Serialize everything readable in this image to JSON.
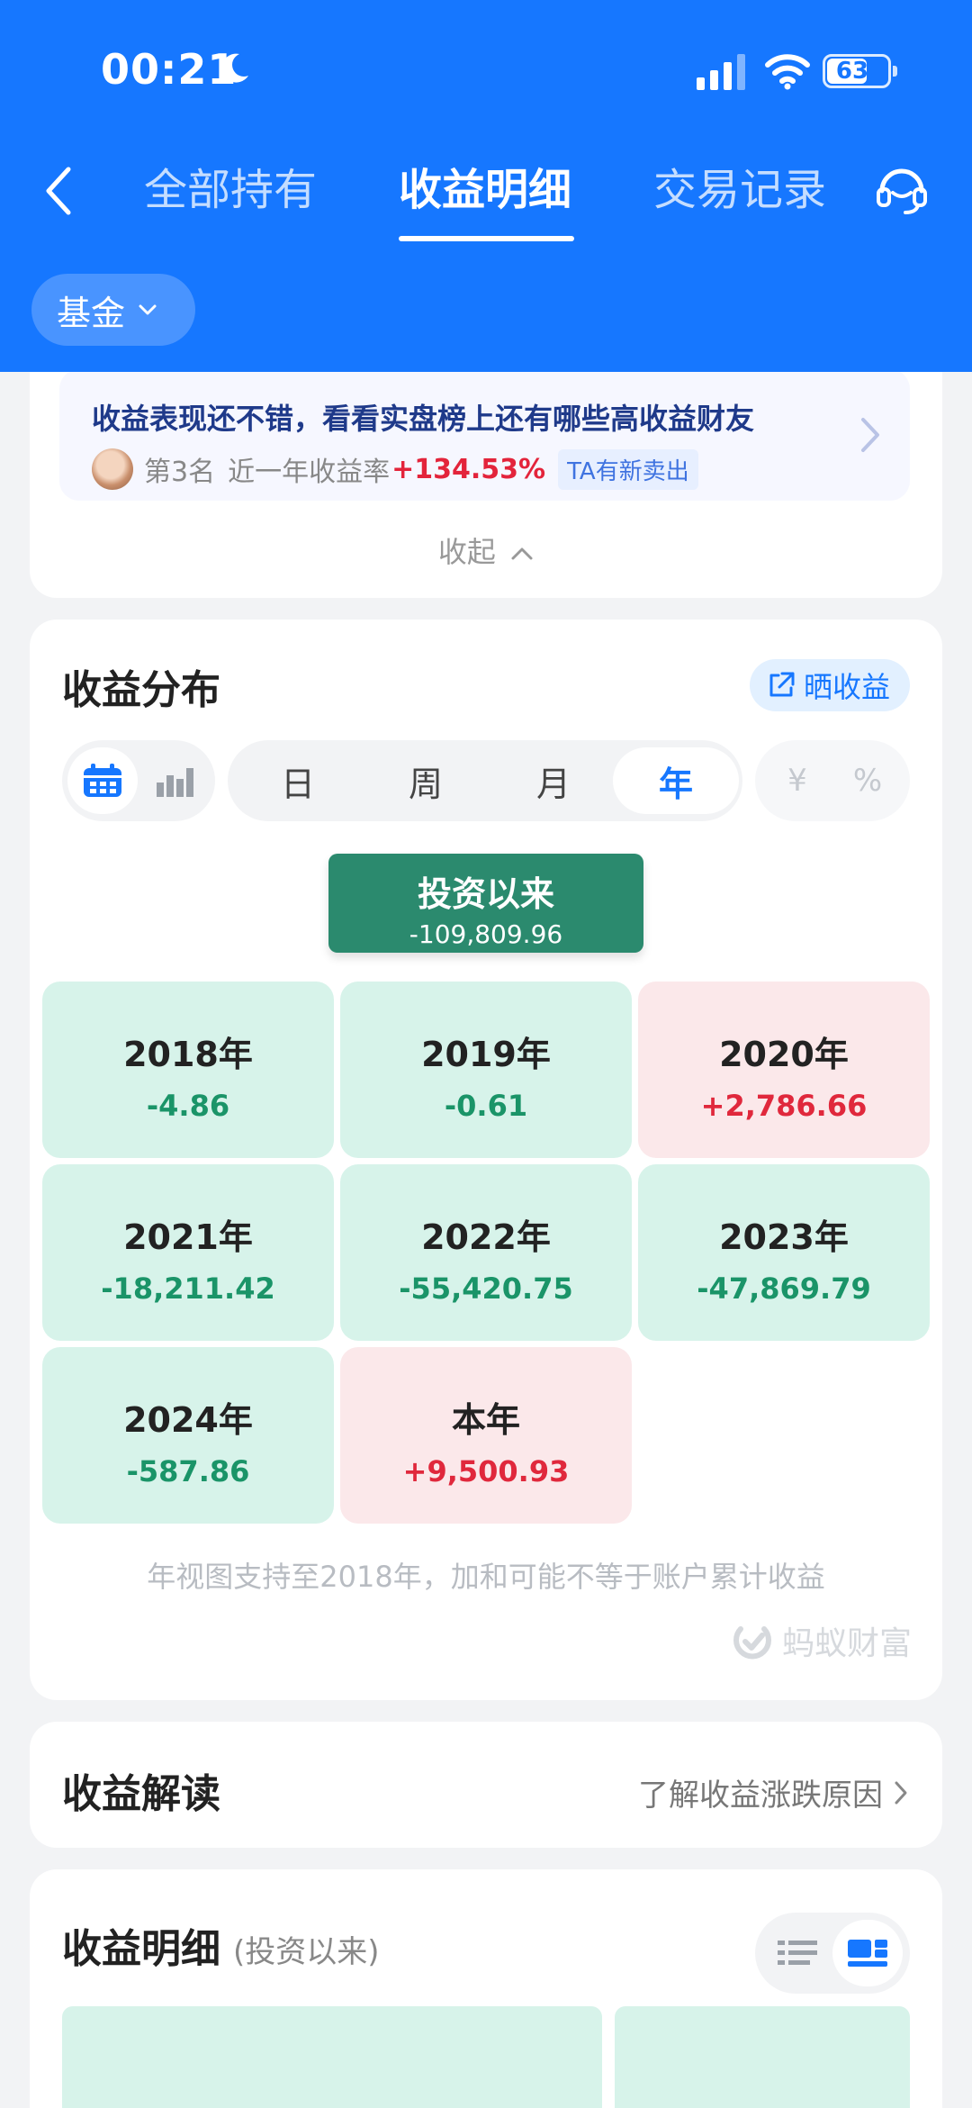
{
  "status_bar": {
    "time": "00:21",
    "battery": "63",
    "icons": [
      "moon-icon",
      "signal-icon",
      "wifi-icon",
      "battery-icon"
    ]
  },
  "nav": {
    "tabs": [
      {
        "label": "全部持有",
        "active": false
      },
      {
        "label": "收益明细",
        "active": true
      },
      {
        "label": "交易记录",
        "active": false
      }
    ],
    "icons": [
      "back-icon",
      "customer-service-icon"
    ]
  },
  "filter": {
    "label": "基金"
  },
  "rank_banner": {
    "title": "收益表现还不错，看看实盘榜上还有哪些高收益财友",
    "rank": "第3名",
    "rate_label": "近一年收益率",
    "rate_value": "+134.53%",
    "tag": "TA有新卖出",
    "collapse": "收起"
  },
  "distribution": {
    "title": "收益分布",
    "share": "晒收益",
    "periods": [
      "日",
      "周",
      "月",
      "年"
    ],
    "active_period": "年",
    "units": [
      "¥",
      "%"
    ],
    "since": {
      "label": "投资以来",
      "value": "-109,809.96"
    },
    "years": [
      {
        "label": "2018年",
        "value": "-4.86",
        "sign": "loss"
      },
      {
        "label": "2019年",
        "value": "-0.61",
        "sign": "loss"
      },
      {
        "label": "2020年",
        "value": "+2,786.66",
        "sign": "gain"
      },
      {
        "label": "2021年",
        "value": "-18,211.42",
        "sign": "loss"
      },
      {
        "label": "2022年",
        "value": "-55,420.75",
        "sign": "loss"
      },
      {
        "label": "2023年",
        "value": "-47,869.79",
        "sign": "loss"
      },
      {
        "label": "2024年",
        "value": "-587.86",
        "sign": "loss"
      },
      {
        "label": "本年",
        "value": "+9,500.93",
        "sign": "gain"
      }
    ],
    "note": "年视图支持至2018年，加和可能不等于账户累计收益",
    "brand": "蚂蚁财富"
  },
  "interpretation": {
    "title": "收益解读",
    "link": "了解收益涨跌原因"
  },
  "detail": {
    "title": "收益明细",
    "subtitle": "(投资以来)"
  },
  "colors": {
    "primary": "#1677ff",
    "loss_bg": "#d7f3ea",
    "loss_text": "#1a9468",
    "gain_bg": "#fbe8ea",
    "gain_text": "#e0283c",
    "since_bg": "#2b8a6e"
  }
}
